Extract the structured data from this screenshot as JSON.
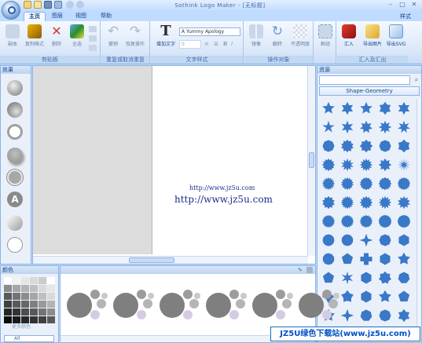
{
  "window": {
    "title": "Sothink Logo Maker - [无标题]"
  },
  "tabs": [
    {
      "label": "主页",
      "active": true
    },
    {
      "label": "图层",
      "active": false
    },
    {
      "label": "视图",
      "active": false
    },
    {
      "label": "帮助",
      "active": false
    }
  ],
  "style_menu": "样式",
  "ribbon": {
    "clipboard": {
      "label": "剪贴板",
      "buttons": [
        "副本",
        "复制格式",
        "删除",
        "全选"
      ]
    },
    "undo": {
      "label": "重复或取消重复",
      "buttons": [
        "撤销",
        "恢复操作"
      ]
    },
    "text": {
      "label": "文字样式",
      "add_text": "增加文字",
      "font": "A Yummy Apology",
      "size": "0"
    },
    "operate": {
      "label": "操作对象",
      "buttons": [
        "镜像",
        "翻转",
        "不透明度"
      ]
    },
    "group": {
      "buttons": [
        "群组"
      ]
    },
    "io": {
      "label": "汇入及汇出",
      "buttons": [
        "汇入",
        "导出图片",
        "导出SVG"
      ]
    }
  },
  "effects": {
    "title": "效果"
  },
  "canvas": {
    "url_small": "http://www.jz5u.com",
    "url_large": "http://www.jz5u.com"
  },
  "resources": {
    "title": "资源",
    "search_value": "",
    "category": "Shape-Geometry"
  },
  "colors": {
    "title": "颜色",
    "more_colors": "更多颜色",
    "filter": "All",
    "swatches": [
      "#ffffff",
      "#f2f2f2",
      "#e6e6e6",
      "#d9d9d9",
      "#cccccc",
      "#ffffff",
      "#8c8c8c",
      "#a6a6a6",
      "#b3b3b3",
      "#bfbfbf",
      "#d9d9d9",
      "#e6e6e6",
      "#595959",
      "#737373",
      "#8c8c8c",
      "#a6a6a6",
      "#bfbfbf",
      "#d9d9d9",
      "#404040",
      "#595959",
      "#666666",
      "#808080",
      "#999999",
      "#b3b3b3",
      "#262626",
      "#333333",
      "#4d4d4d",
      "#595959",
      "#737373",
      "#8c8c8c",
      "#0d0d0d",
      "#1a1a1a",
      "#262626",
      "#333333",
      "#404040",
      "#595959"
    ]
  },
  "watermark": "JZ5U绿色下载站(www.jz5u.com)"
}
